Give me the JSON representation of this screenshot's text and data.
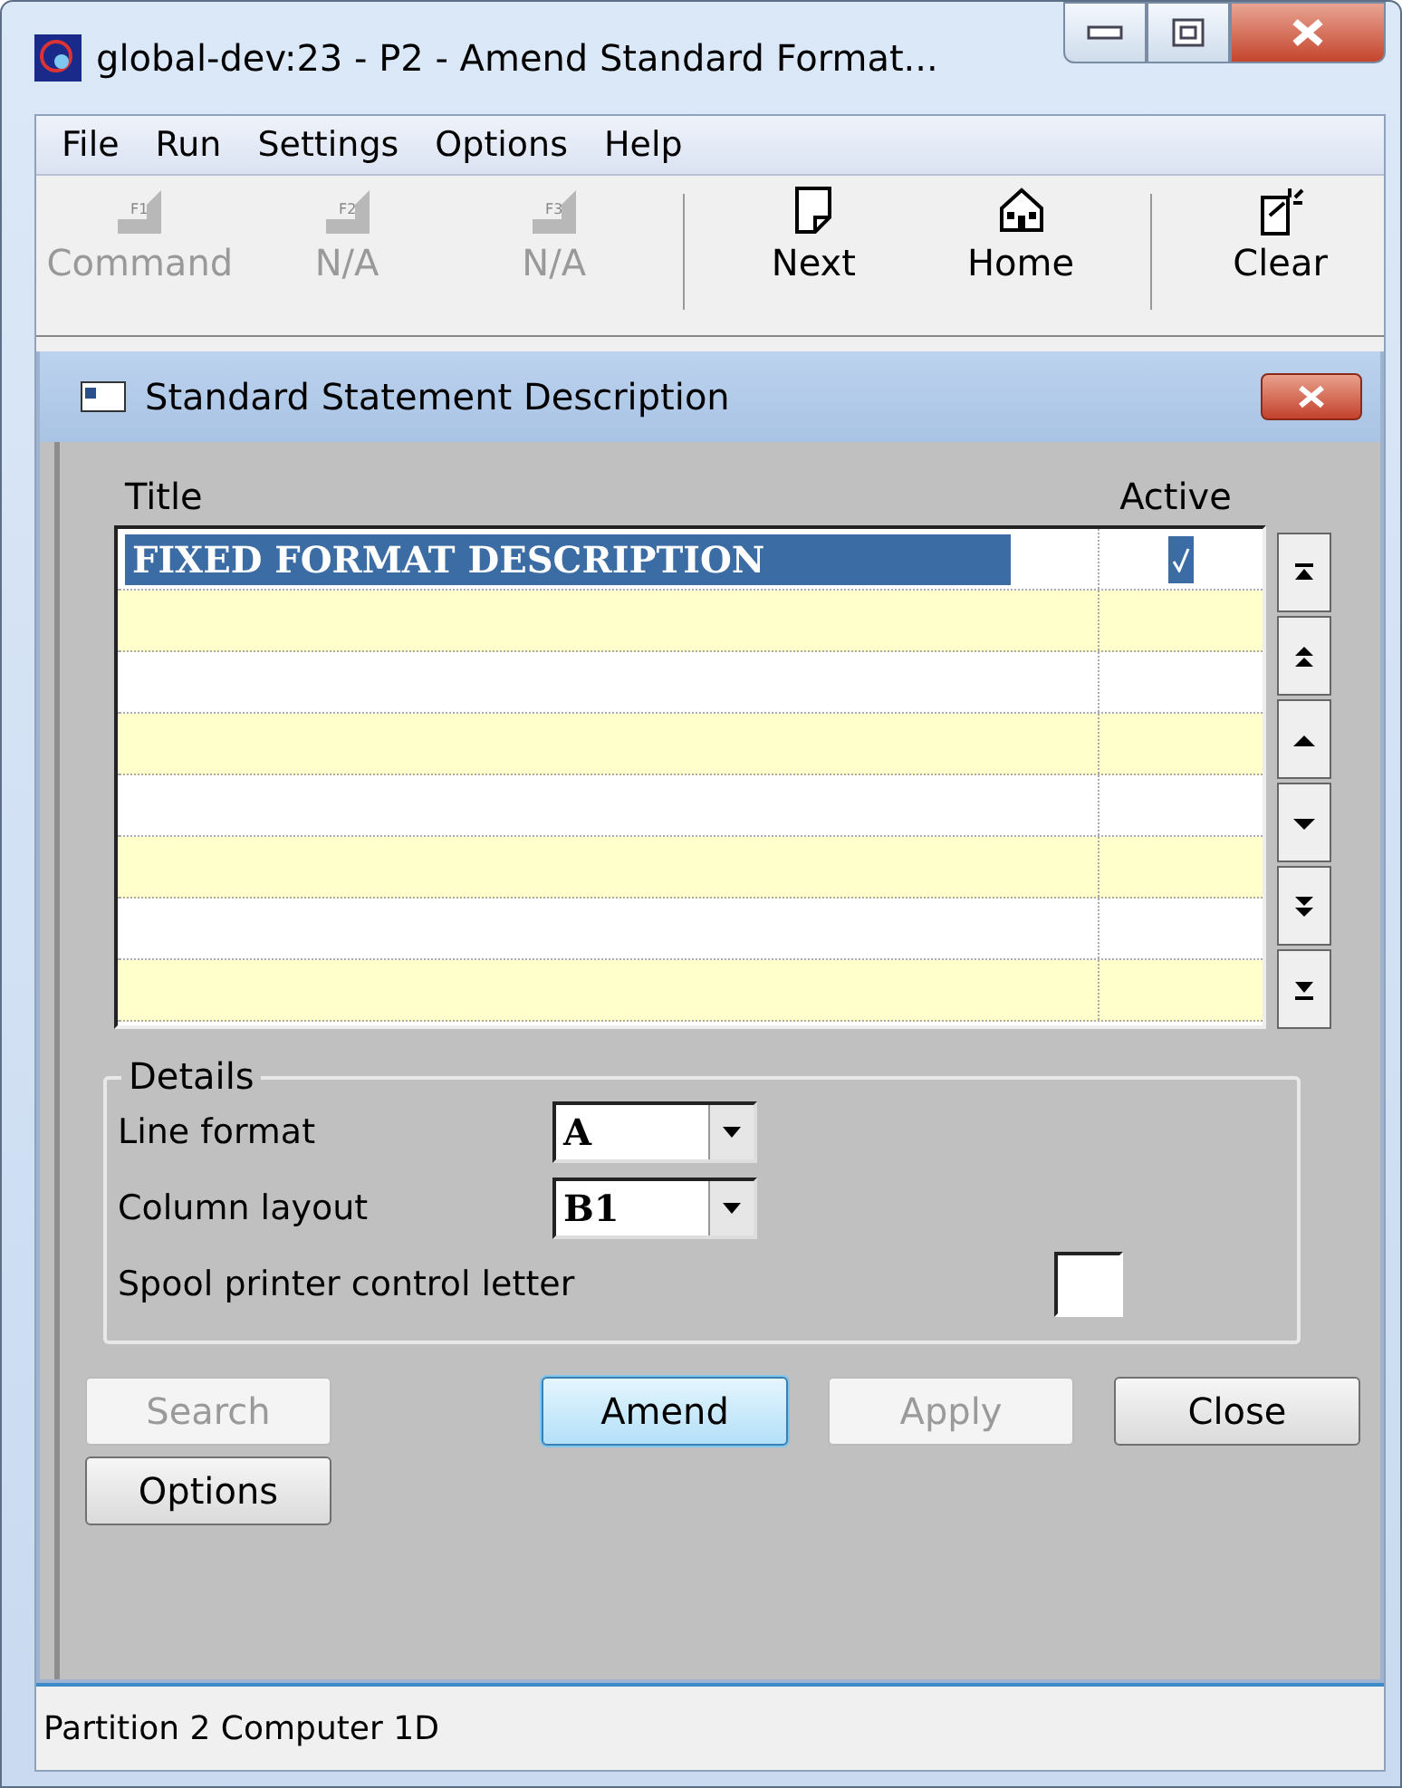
{
  "window": {
    "title": "global-dev:23 - P2 - Amend Standard Format..."
  },
  "menu": [
    {
      "label": "File"
    },
    {
      "label": "Run"
    },
    {
      "label": "Settings"
    },
    {
      "label": "Options"
    },
    {
      "label": "Help"
    }
  ],
  "toolbar": [
    {
      "kind": "fkey",
      "key": "F1",
      "label": "Command",
      "disabled": true
    },
    {
      "kind": "fkey",
      "key": "F2",
      "label": "N/A",
      "disabled": true
    },
    {
      "kind": "fkey",
      "key": "F3",
      "label": "N/A",
      "disabled": true
    },
    {
      "kind": "separator"
    },
    {
      "kind": "page",
      "label": "Next",
      "disabled": false
    },
    {
      "kind": "house",
      "label": "Home",
      "disabled": false
    },
    {
      "kind": "separator"
    },
    {
      "kind": "clear",
      "label": "Clear",
      "disabled": false
    }
  ],
  "dialog": {
    "title": "Standard Statement Description",
    "table": {
      "columns": [
        "Title",
        "Active"
      ],
      "rows": [
        {
          "title": "FIXED FORMAT DESCRIPTION",
          "active": true,
          "selected": true
        }
      ]
    },
    "details": {
      "legend": "Details",
      "fields": [
        {
          "kind": "combo",
          "label": "Line format",
          "value": "A"
        },
        {
          "kind": "combo",
          "label": "Column layout",
          "value": "B1"
        },
        {
          "kind": "text",
          "label": "Spool printer control letter"
        }
      ]
    },
    "buttons": [
      {
        "label": "Search",
        "disabled": true,
        "default": false
      },
      {
        "label": "Amend",
        "disabled": false,
        "default": true
      },
      {
        "label": "Apply",
        "disabled": true,
        "default": false
      },
      {
        "label": "Close",
        "disabled": false,
        "default": false
      },
      {
        "label": "Options",
        "disabled": false,
        "default": false
      }
    ]
  },
  "status_bar": {
    "text": "Partition 2 Computer 1D"
  }
}
